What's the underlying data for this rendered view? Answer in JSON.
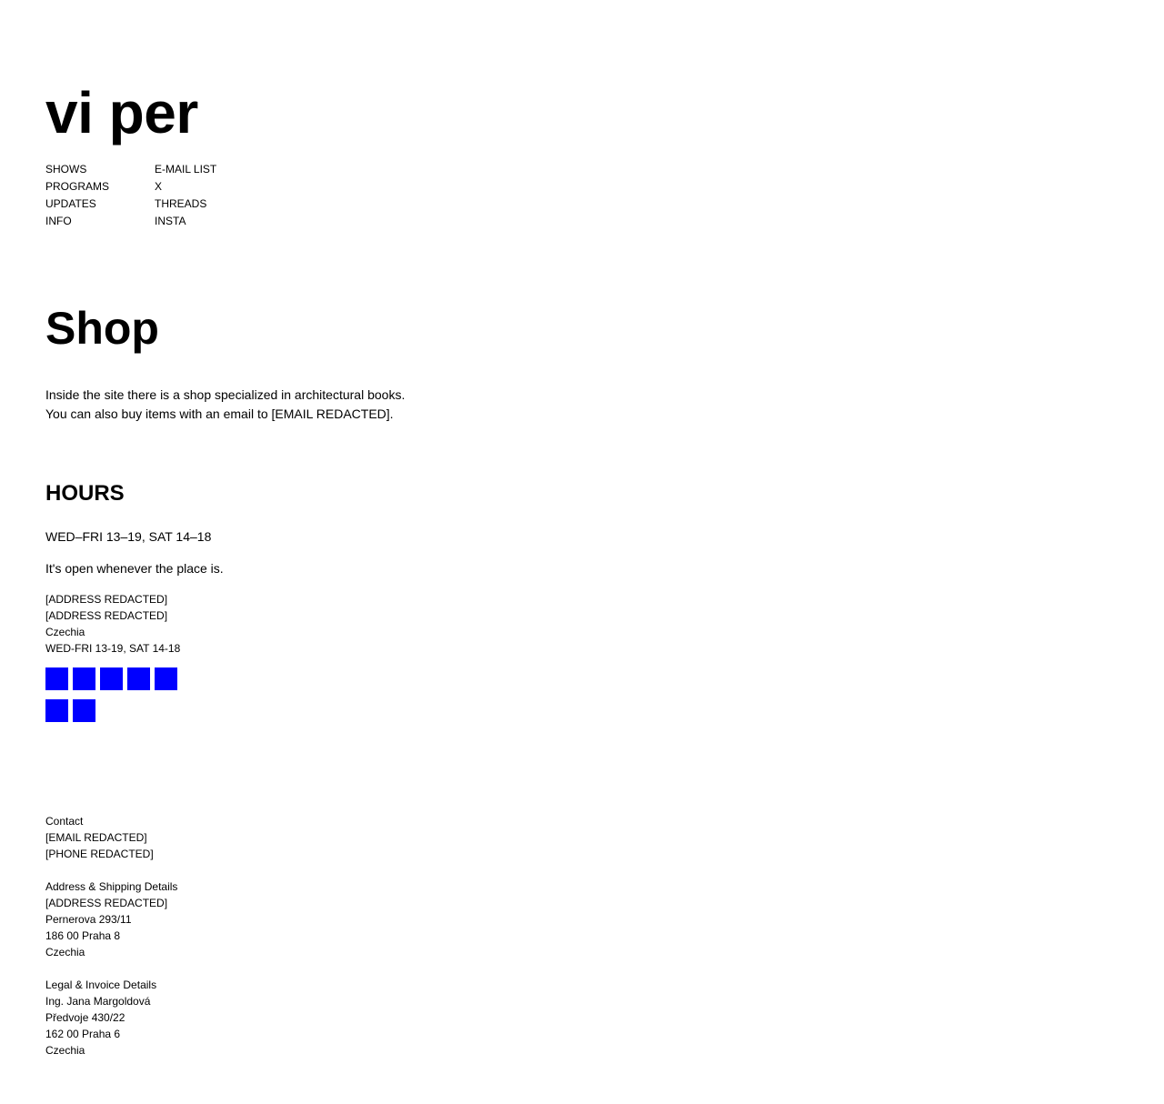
{
  "site": {
    "logo": "vi per"
  },
  "nav": {
    "left": [
      "SHOWS",
      "PROGRAMS",
      "UPDATES",
      "INFO"
    ],
    "right": [
      "E-MAIL LIST",
      "X",
      "THREADS",
      "INSTA"
    ]
  },
  "shop": {
    "title": "Shop",
    "intro_line1": "Inside the site there is a shop specialized in architectural books.",
    "intro_line2": "You can also buy items with an email to [EMAIL REDACTED]."
  },
  "hours": {
    "title": "HOURS",
    "main": "WED–FRI 13–19, SAT 14–18",
    "open_note": "It's open whenever the place is.",
    "address_lines": [
      "[ADDRESS REDACTED]",
      "[ADDRESS REDACTED]",
      "Czechia",
      "WED-FRI 13-19, SAT 14-18"
    ]
  },
  "tiles": {
    "color": "#0000ff",
    "row1_count": 5,
    "row2_count": 2
  },
  "footer": {
    "contact": {
      "heading": "Contact",
      "lines": [
        "[EMAIL REDACTED]",
        "[PHONE REDACTED]"
      ]
    },
    "shipping": {
      "heading": "Address & Shipping Details",
      "lines": [
        "[ADDRESS REDACTED]",
        "Pernerova 293/11",
        "186 00 Praha 8",
        "Czechia"
      ]
    },
    "legal": {
      "heading": "Legal & Invoice Details",
      "lines": [
        "Ing. Jana Margoldová",
        "Předvoje 430/22",
        "162 00 Praha 6",
        "Czechia"
      ]
    }
  }
}
